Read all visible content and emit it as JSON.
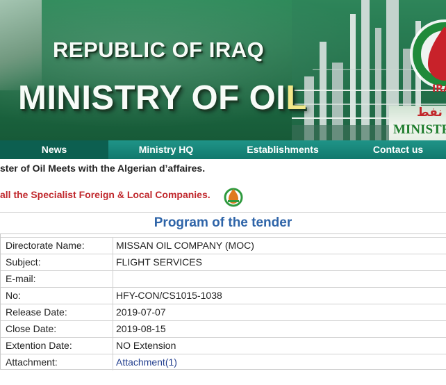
{
  "header": {
    "title_line1": "REPUBLIC OF IRAQ",
    "title_line2_main": "MINISTRY OF OI",
    "title_line2_tail": "L",
    "logo_text": "IRAQ",
    "arabic_word": "نفط",
    "ministry_word": "MINISTR"
  },
  "nav": {
    "items": [
      {
        "label": "News",
        "active": true
      },
      {
        "label": "Ministry HQ",
        "active": false
      },
      {
        "label": "Establishments",
        "active": false
      },
      {
        "label": "Contact us",
        "active": false
      }
    ]
  },
  "ticker": {
    "headline": "ster of Oil Meets with the Algerian d’affaires."
  },
  "announcement": {
    "text": "all the Specialist Foreign & Local Companies.",
    "icon": "oil-drop-logo-icon"
  },
  "tender": {
    "title": "Program of the tender",
    "rows": [
      {
        "label": "Directorate Name:",
        "value": "MISSAN OIL COMPANY (MOC)"
      },
      {
        "label": "Subject:",
        "value": "FLIGHT SERVICES"
      },
      {
        "label": "E-mail:",
        "value": ""
      },
      {
        "label": "No:",
        "value": "HFY-CON/CS1015-1038"
      },
      {
        "label": "Release Date:",
        "value": "2019-07-07"
      },
      {
        "label": "Close Date:",
        "value": "2019-08-15"
      },
      {
        "label": "Extention Date:",
        "value": "NO Extension"
      },
      {
        "label": "Attachment:",
        "value": "Attachment(1)"
      }
    ]
  },
  "colors": {
    "banner_green": "#1f7046",
    "nav_teal": "#12786d",
    "nav_active": "#0c5f50",
    "tender_title_blue": "#2e64a8",
    "announce_red": "#c0282d",
    "link_blue": "#24408f"
  }
}
